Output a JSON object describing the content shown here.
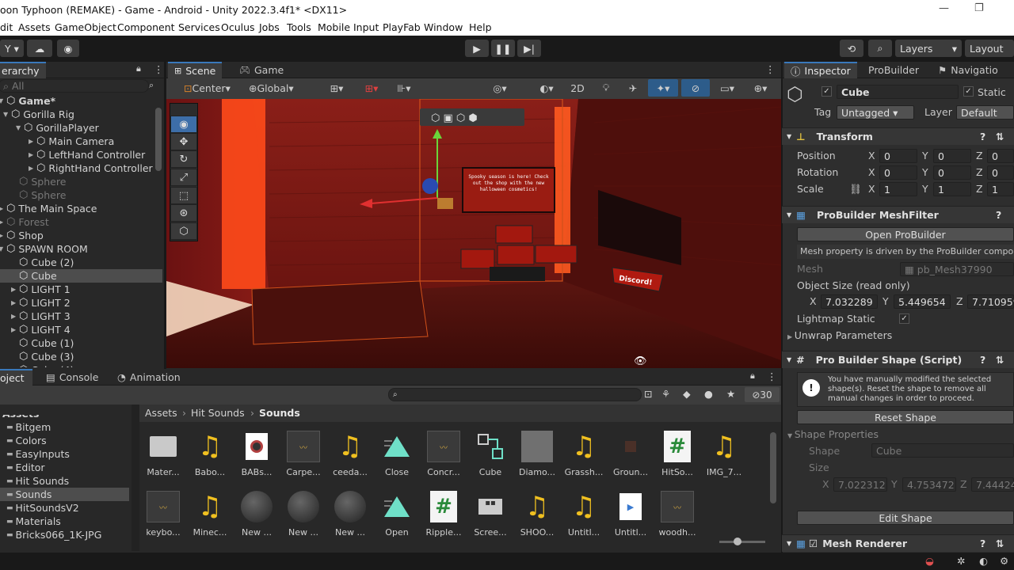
{
  "window": {
    "title": "oon Typhoon (REMAKE) - Game - Android - Unity 2022.3.4f1* <DX11>"
  },
  "menu": [
    "dit",
    "Assets",
    "GameObject",
    "Component",
    "Services",
    "Oculus",
    "Jobs",
    "Tools",
    "Mobile Input",
    "PlayFab",
    "Window",
    "Help"
  ],
  "toolbar": {
    "account": "Y",
    "layers": "Layers",
    "layout": "Layout"
  },
  "hierarchy": {
    "tab": "erarchy",
    "search_placeholder": "All",
    "items": [
      {
        "label": "Game*",
        "bold": true
      },
      {
        "label": "Gorilla Rig"
      },
      {
        "label": "GorillaPlayer"
      },
      {
        "label": "Main Camera"
      },
      {
        "label": "LeftHand Controller"
      },
      {
        "label": "RightHand Controller"
      },
      {
        "label": "Sphere"
      },
      {
        "label": "Sphere"
      },
      {
        "label": "The Main Space"
      },
      {
        "label": "Forest"
      },
      {
        "label": "Shop"
      },
      {
        "label": "SPAWN ROOM"
      },
      {
        "label": "Cube (2)"
      },
      {
        "label": "Cube"
      },
      {
        "label": "LIGHT 1"
      },
      {
        "label": "LIGHT 2"
      },
      {
        "label": "LIGHT 3"
      },
      {
        "label": "LIGHT 4"
      },
      {
        "label": "Cube (1)"
      },
      {
        "label": "Cube (3)"
      },
      {
        "label": "Cube (4)"
      }
    ]
  },
  "scene": {
    "tabs": [
      "Scene",
      "Game"
    ],
    "pivot": "Center",
    "space": "Global",
    "mode2d": "2D",
    "sign_text": "Spooky season is here! Check out the shop with the new halloween cosmetics!",
    "discord": "Discord!"
  },
  "project": {
    "tabs": [
      "oject",
      "Console",
      "Animation"
    ],
    "count": "30",
    "breadcrumb": [
      "Assets",
      "Hit Sounds",
      "Sounds"
    ],
    "tree": [
      "Assets",
      "Bitgem",
      "Colors",
      "EasyInputs",
      "Editor",
      "Hit Sounds",
      "Sounds",
      "HitSoundsV2",
      "Materials",
      "Bricks066_1K-JPG"
    ],
    "assets_row1": [
      "Mater...",
      "Babo...",
      "BABs...",
      "Carpe...",
      "ceeda...",
      "Close",
      "Concr...",
      "Cube",
      "Diamo...",
      "Grassh...",
      "Groun...",
      "HitSo...",
      "IMG_7..."
    ],
    "assets_row2": [
      "keybo...",
      "Minec...",
      "New ...",
      "New ...",
      "New ...",
      "Open",
      "Ripple...",
      "Scree...",
      "SHOO...",
      "Untitl...",
      "Untitl...",
      "woodh..."
    ]
  },
  "inspector": {
    "tabs": [
      "Inspector",
      "ProBuilder",
      "Navigatio"
    ],
    "name": "Cube",
    "static": "Static",
    "tag_label": "Tag",
    "tag": "Untagged",
    "layer_label": "Layer",
    "layer": "Default",
    "transform": "Transform",
    "position": [
      "Position",
      "X",
      "0",
      "Y",
      "0",
      "Z",
      "0"
    ],
    "rotation": [
      "Rotation",
      "X",
      "0",
      "Y",
      "0",
      "Z",
      "0"
    ],
    "scale": [
      "Scale",
      "X",
      "1",
      "Y",
      "1",
      "Z",
      "1"
    ],
    "meshfilter": "ProBuilder MeshFilter",
    "open_pb": "Open ProBuilder",
    "mesh_note": "Mesh property is driven by the ProBuilder componer",
    "mesh_label": "Mesh",
    "mesh_value": "pb_Mesh37990",
    "objsize_label": "Object Size (read only)",
    "objsize": [
      "X",
      "7.032289",
      "Y",
      "5.449654",
      "Z",
      "7.710959"
    ],
    "lightmap": "Lightmap Static",
    "unwrap": "Unwrap Parameters",
    "shape_script": "Pro Builder Shape (Script)",
    "shape_warning": "You have manually modified the selected shape(s). Reset the shape to remove all manual changes in order to proceed.",
    "reset_shape": "Reset Shape",
    "shape_props": "Shape Properties",
    "shape_label": "Shape",
    "shape_value": "Cube",
    "size_label": "Size",
    "size": [
      "X",
      "7.022312",
      "Y",
      "4.753472",
      "Z",
      "7.44424"
    ],
    "edit_shape": "Edit Shape",
    "mesh_renderer": "Mesh Renderer"
  }
}
